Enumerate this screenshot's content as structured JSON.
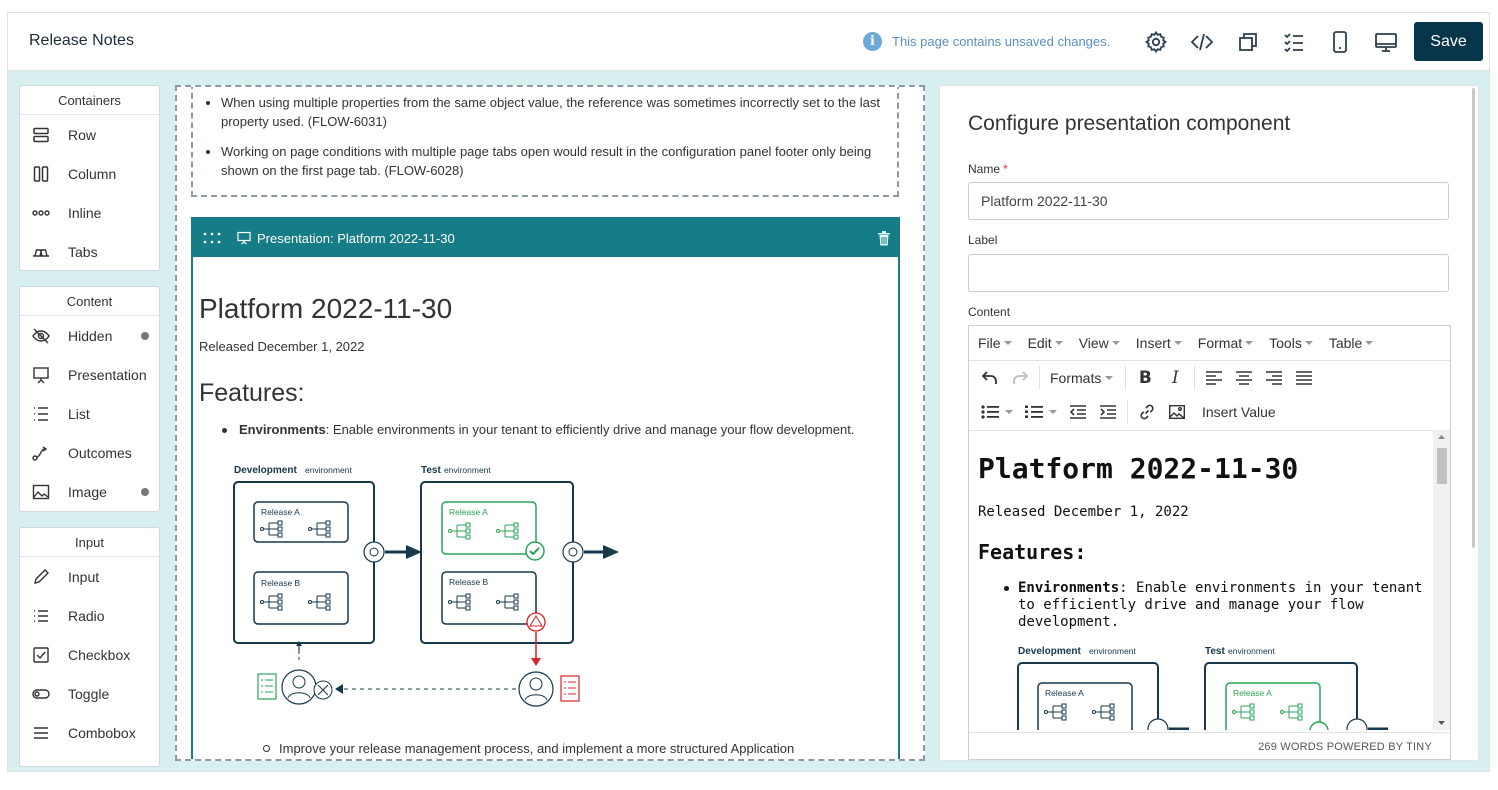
{
  "header": {
    "title": "Release Notes",
    "notice": "This page contains unsaved changes.",
    "save_label": "Save"
  },
  "palette": {
    "containers": {
      "title": "Containers",
      "items": [
        {
          "label": "Row",
          "icon": "row-icon"
        },
        {
          "label": "Column",
          "icon": "column-icon"
        },
        {
          "label": "Inline",
          "icon": "inline-icon"
        },
        {
          "label": "Tabs",
          "icon": "tabs-icon"
        }
      ]
    },
    "content": {
      "title": "Content",
      "items": [
        {
          "label": "Hidden",
          "icon": "eye-slash-icon"
        },
        {
          "label": "Presentation",
          "icon": "presentation-icon"
        },
        {
          "label": "List",
          "icon": "list-icon"
        },
        {
          "label": "Outcomes",
          "icon": "outcomes-icon"
        },
        {
          "label": "Image",
          "icon": "image-icon"
        }
      ]
    },
    "input": {
      "title": "Input",
      "items": [
        {
          "label": "Input",
          "icon": "pencil-icon"
        },
        {
          "label": "Radio",
          "icon": "radio-list-icon"
        },
        {
          "label": "Checkbox",
          "icon": "checkbox-icon"
        },
        {
          "label": "Toggle",
          "icon": "toggle-icon"
        },
        {
          "label": "Combobox",
          "icon": "combobox-icon"
        }
      ]
    }
  },
  "canvas": {
    "previous_bullets": [
      "When using multiple properties from the same object value, the reference was sometimes incorrectly set to the last property used. (FLOW-6031)",
      "Working on page conditions with multiple page tabs open would result in the configuration panel footer only being shown on the first page tab. (FLOW-6028)"
    ],
    "presentation": {
      "header": "Presentation: Platform 2022-11-30",
      "title": "Platform 2022-11-30",
      "released": "Released December 1, 2022",
      "features_heading": "Features:",
      "env_bold": "Environments",
      "env_text": ": Enable environments in your tenant to efficiently drive and manage your flow development.",
      "sub_bullet": "Improve your release management process, and implement a more structured Application",
      "diagram": {
        "dev_label": "Development",
        "test_label": "Test",
        "env_word": "environment",
        "release_a": "Release A",
        "release_b": "Release B"
      }
    }
  },
  "config": {
    "title": "Configure presentation component",
    "name_label": "Name",
    "name_value": "Platform 2022-11-30",
    "label_label": "Label",
    "label_value": "",
    "content_label": "Content",
    "menubar": [
      "File",
      "Edit",
      "View",
      "Insert",
      "Format",
      "Tools",
      "Table"
    ],
    "formats_label": "Formats",
    "insert_value_label": "Insert Value",
    "editor": {
      "title": "Platform 2022-11-30",
      "released": "Released December 1, 2022",
      "features_heading": "Features:",
      "env_bold": "Environments",
      "env_text": ": Enable environments in your tenant to efficiently drive and manage your flow development."
    },
    "status": "269 WORDS POWERED BY TINY"
  },
  "colors": {
    "brand_dark": "#07354a",
    "teal": "#167d86",
    "notice_blue": "#5b8fbd",
    "canvas_bg": "#d8efef",
    "diagram_green": "#27a556",
    "diagram_red": "#d8232a"
  }
}
